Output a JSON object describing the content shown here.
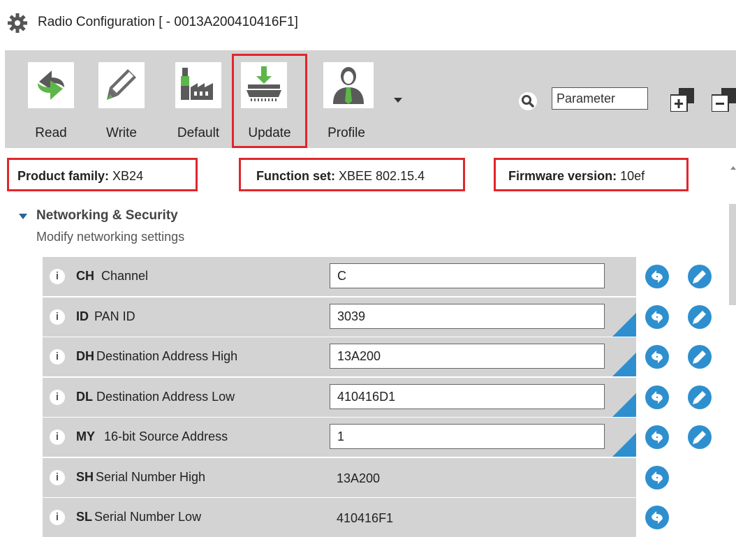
{
  "window": {
    "title": "Radio Configuration [ - 0013A200410416F1]",
    "icon": "gear-icon"
  },
  "toolbar": {
    "buttons": [
      {
        "label": "Read",
        "icon": "read-icon"
      },
      {
        "label": "Write",
        "icon": "write-pencil-icon"
      },
      {
        "label": "Default",
        "icon": "factory-icon"
      },
      {
        "label": "Update",
        "icon": "firmware-update-icon",
        "highlighted": true
      },
      {
        "label": "Profile",
        "icon": "profile-user-icon"
      }
    ],
    "search": {
      "placeholder": "Parameter"
    }
  },
  "info": {
    "product_family_label": "Product family:",
    "product_family_value": "XB24",
    "function_set_label": "Function set:",
    "function_set_value": "XBEE 802.15.4",
    "firmware_version_label": "Firmware version:",
    "firmware_version_value": "10ef"
  },
  "section": {
    "title": "Networking & Security",
    "description": "Modify networking settings"
  },
  "parameters": [
    {
      "code": "CH",
      "name": "Channel",
      "value": "C",
      "editable": true,
      "modified": false
    },
    {
      "code": "ID",
      "name": "PAN ID",
      "value": "3039",
      "editable": true,
      "modified": true
    },
    {
      "code": "DH",
      "name": "Destination Address High",
      "value": "13A200",
      "editable": true,
      "modified": true
    },
    {
      "code": "DL",
      "name": "Destination Address Low",
      "value": "410416D1",
      "editable": true,
      "modified": true
    },
    {
      "code": "MY",
      "name": "16-bit Source Address",
      "value": "1",
      "editable": true,
      "modified": true
    },
    {
      "code": "SH",
      "name": "Serial Number High",
      "value": "13A200",
      "editable": false,
      "modified": false
    },
    {
      "code": "SL",
      "name": "Serial Number Low",
      "value": "410416F1",
      "editable": false,
      "modified": false
    }
  ],
  "colors": {
    "highlight_box": "#e0262c",
    "accent_blue": "#2e8fcf",
    "toolbar_bg": "#d3d3d3"
  }
}
